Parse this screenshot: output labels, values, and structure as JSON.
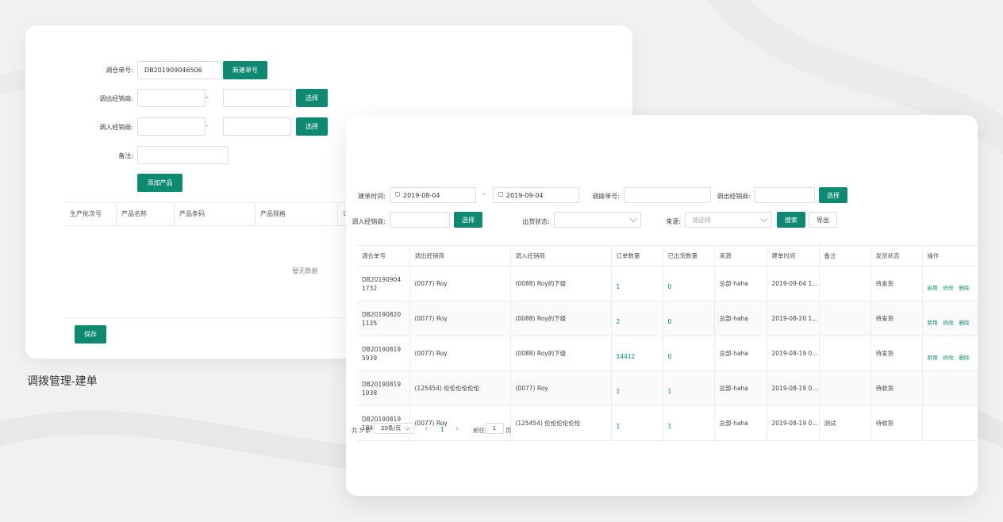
{
  "caption": "调拨管理-建单",
  "create_form": {
    "transfer_no_label": "调仓单号:",
    "transfer_no_value": "DB201909046506",
    "new_no_button": "新建单号",
    "out_dealer_label": "调出经销商:",
    "in_dealer_label": "调入经销商:",
    "dash": "-",
    "select_button": "选择",
    "remark_label": "备注:",
    "add_product_button": "添加产品",
    "save_button": "保存",
    "product_table": {
      "columns": [
        "生产批次号",
        "产品名称",
        "产品条码",
        "产品规格",
        "订"
      ],
      "empty_text": "暂无数据"
    }
  },
  "list_view": {
    "filters": {
      "created_time_label": "建单时间:",
      "date_from": "2019-08-04",
      "date_to": "2019-09-04",
      "dash": "-",
      "transfer_no_label": "调拨单号:",
      "out_dealer_label": "调出经销商:",
      "in_dealer_label": "调入经销商:",
      "select_button": "选择",
      "ship_status_label": "出货状态:",
      "source_label": "来源:",
      "source_placeholder": "请选择",
      "search_button": "搜索",
      "export_button": "导出"
    },
    "table": {
      "columns": [
        "调仓单号",
        "调出经销商",
        "调入经销商",
        "订单数量",
        "已出货数量",
        "来源",
        "建单时间",
        "备注",
        "发货状态",
        "操作"
      ],
      "rows": [
        {
          "no": "DB201909041732",
          "out": "(0077) Roy",
          "in": "(0088) Roy的下级",
          "qty": "1",
          "shipped": "0",
          "source": "总部-haha",
          "time": "2019-09-04 1...",
          "remark": "",
          "status": "待发货",
          "ops": [
            "启用",
            "修改",
            "删除"
          ]
        },
        {
          "no": "DB201908201135",
          "out": "(0077) Roy",
          "in": "(0088) Roy的下级",
          "qty": "2",
          "shipped": "0",
          "source": "总部-haha",
          "time": "2019-08-20 1...",
          "remark": "",
          "status": "待发货",
          "ops": [
            "禁用",
            "修改",
            "删除"
          ]
        },
        {
          "no": "DB201908195939",
          "out": "(0077) Roy",
          "in": "(0088) Roy的下级",
          "qty": "14412",
          "shipped": "0",
          "source": "总部-haha",
          "time": "2019-08-19 0...",
          "remark": "",
          "status": "待发货",
          "ops": [
            "禁用",
            "修改",
            "删除"
          ]
        },
        {
          "no": "DB201908191938",
          "out": "(125454) 伦伦伦伦伦伦",
          "in": "(0077) Roy",
          "qty": "1",
          "shipped": "1",
          "source": "总部-haha",
          "time": "2019-08-19 0...",
          "remark": "",
          "status": "待收货",
          "ops": []
        },
        {
          "no": "DB201908191842",
          "out": "(0077) Roy",
          "in": "(125454) 伦伦伦伦伦伦",
          "qty": "1",
          "shipped": "1",
          "source": "总部-haha",
          "time": "2019-08-19 0...",
          "remark": "测试",
          "status": "待收货",
          "ops": []
        }
      ]
    },
    "pagination": {
      "total": "共 5 条",
      "page_size": "20条/页",
      "prev": "‹",
      "current": "1",
      "next": "›",
      "goto_label": "前往",
      "goto_value": "1",
      "page_unit": "页"
    }
  }
}
